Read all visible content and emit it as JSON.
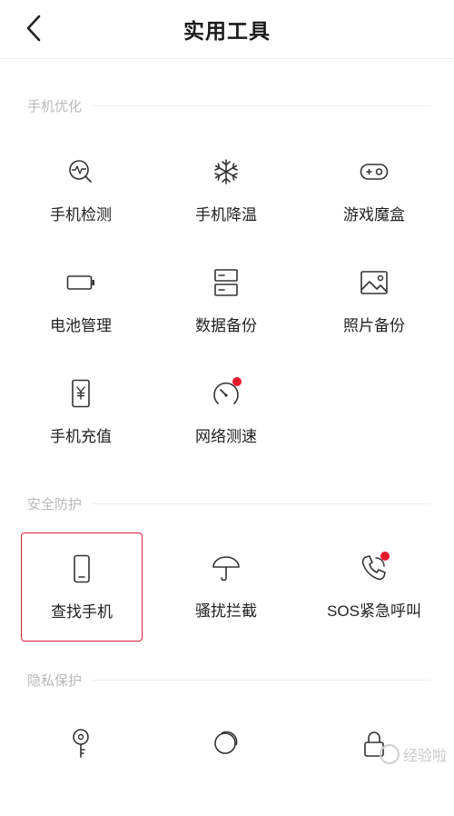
{
  "header": {
    "title": "实用工具"
  },
  "sections": [
    {
      "title": "手机优化",
      "items": [
        {
          "label": "手机检测",
          "icon": "phone-check-icon"
        },
        {
          "label": "手机降温",
          "icon": "snowflake-icon"
        },
        {
          "label": "游戏魔盒",
          "icon": "gamepad-icon"
        },
        {
          "label": "电池管理",
          "icon": "battery-icon"
        },
        {
          "label": "数据备份",
          "icon": "data-backup-icon"
        },
        {
          "label": "照片备份",
          "icon": "photo-icon"
        },
        {
          "label": "手机充值",
          "icon": "phone-recharge-icon"
        },
        {
          "label": "网络测速",
          "icon": "speedometer-icon",
          "badge": true
        }
      ]
    },
    {
      "title": "安全防护",
      "items": [
        {
          "label": "查找手机",
          "icon": "phone-icon",
          "selected": true
        },
        {
          "label": "骚扰拦截",
          "icon": "umbrella-icon"
        },
        {
          "label": "SOS紧急呼叫",
          "icon": "phone-call-icon",
          "badge": true
        }
      ]
    },
    {
      "title": "隐私保护",
      "items": [
        {
          "label": "",
          "icon": "key-icon"
        },
        {
          "label": "",
          "icon": "circles-icon"
        },
        {
          "label": "",
          "icon": "lock-icon"
        }
      ]
    }
  ],
  "watermark": {
    "text": "经验啦"
  },
  "colors": {
    "accent": "#e8192c",
    "section_text": "#b9b9b9"
  }
}
